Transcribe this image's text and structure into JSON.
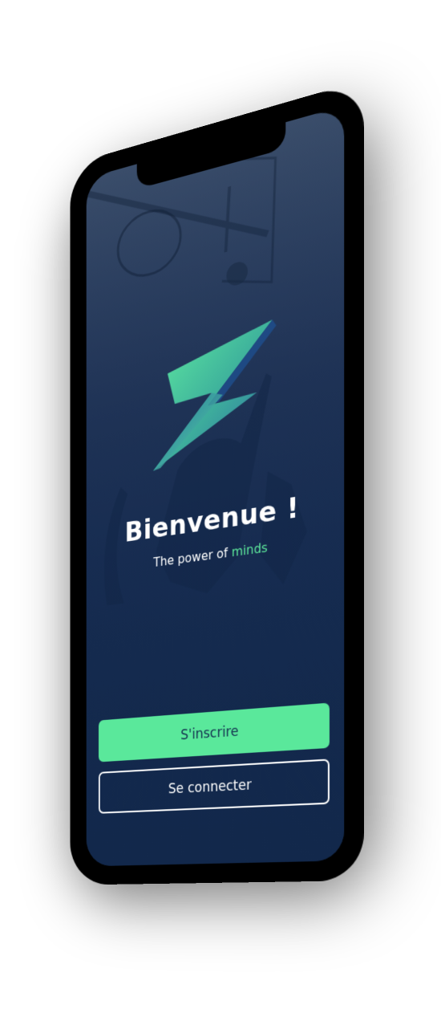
{
  "welcome": {
    "title": "Bienvenue !",
    "tagline_prefix": "The power of",
    "tagline_accent": "minds"
  },
  "actions": {
    "signup_label": "S'inscrire",
    "login_label": "Se connecter"
  },
  "colors": {
    "accent": "#5ae89b",
    "background": "#12284b",
    "text": "#ffffff"
  },
  "icons": {
    "logo": "z-logo-icon",
    "background_image": "basketball-hoop-photo"
  }
}
